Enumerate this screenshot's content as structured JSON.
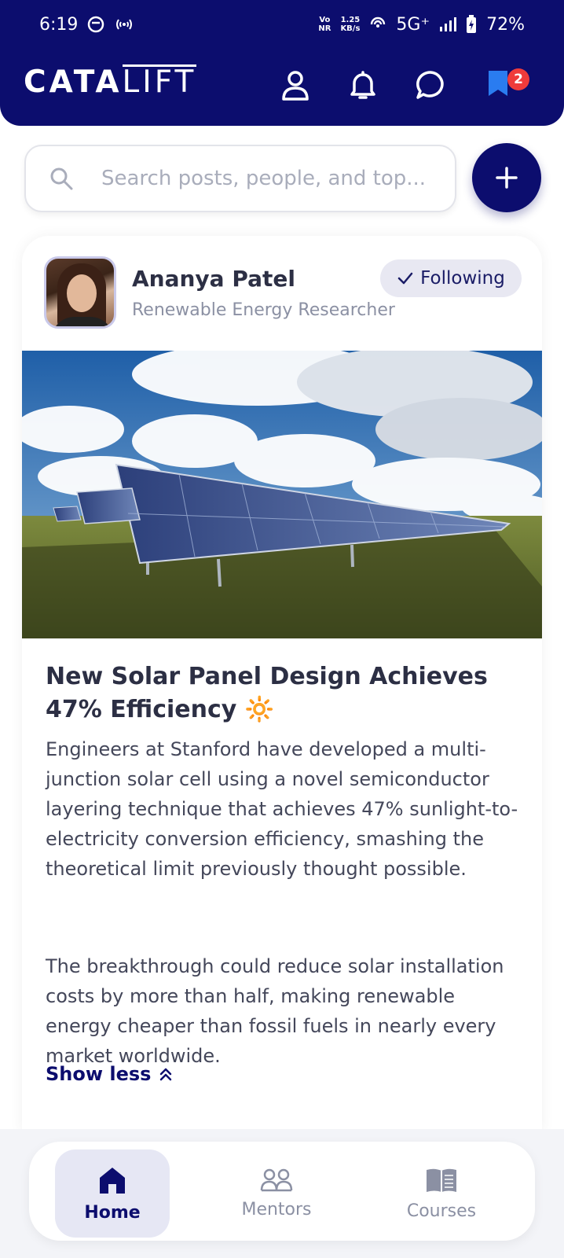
{
  "status_bar": {
    "time": "6:19",
    "network_top": "Vo",
    "network_bottom": "NR",
    "speed_top": "1.25",
    "speed_bottom": "KB/s",
    "signal": "5G⁺",
    "battery": "72%"
  },
  "header": {
    "logo_bold": "CATA",
    "logo_light": "LIFT",
    "notification_count": "2",
    "icons": [
      "profile-icon",
      "bell-icon",
      "chat-icon",
      "bookmark-icon"
    ]
  },
  "search": {
    "placeholder": "Search posts, people, and top..."
  },
  "post": {
    "author_name": "Ananya Patel",
    "author_role": "Renewable Energy Researcher",
    "follow_label": "Following",
    "title": "New Solar Panel Design Achieves 47% Efficiency",
    "title_emoji": "🔆",
    "paragraph_1": "Engineers at Stanford have developed a multi-junction solar cell using a novel semiconductor layering technique that achieves 47% sunlight-to-electricity conversion efficiency, smashing the theoretical limit previously thought possible.",
    "paragraph_2": "The breakthrough could reduce solar installation costs by more than half, making renewable energy cheaper than fossil fuels in nearly every market worldwide.",
    "show_less_label": "Show less"
  },
  "nav": {
    "items": [
      {
        "label": "Home",
        "icon": "home-icon",
        "active": true
      },
      {
        "label": "Mentors",
        "icon": "people-icon",
        "active": false
      },
      {
        "label": "Courses",
        "icon": "book-icon",
        "active": false
      }
    ]
  },
  "colors": {
    "brand": "#0c0d6e",
    "badge": "#ef3b3b"
  }
}
